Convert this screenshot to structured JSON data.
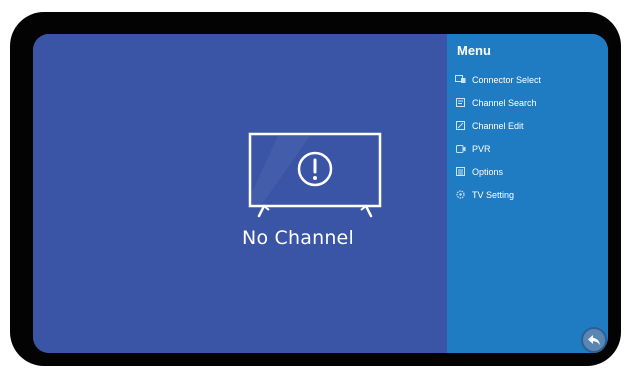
{
  "main": {
    "status_text": "No Channel",
    "status_icon": "tv-warning-icon"
  },
  "menu": {
    "title": "Menu",
    "items": [
      {
        "label": "Connector Select",
        "icon": "input-source-icon"
      },
      {
        "label": "Channel Search",
        "icon": "channel-search-icon"
      },
      {
        "label": "Channel Edit",
        "icon": "channel-edit-icon"
      },
      {
        "label": "PVR",
        "icon": "record-icon"
      },
      {
        "label": "Options",
        "icon": "options-icon"
      },
      {
        "label": "TV Setting",
        "icon": "gear-icon"
      }
    ]
  },
  "back_button": {
    "icon": "back-arrow-icon"
  },
  "colors": {
    "bezel": "#030303",
    "screen_bg": "#3a55a6",
    "menu_bg": "#1f7cc3",
    "text": "#ffffff",
    "back_button": "#5a86b4"
  }
}
